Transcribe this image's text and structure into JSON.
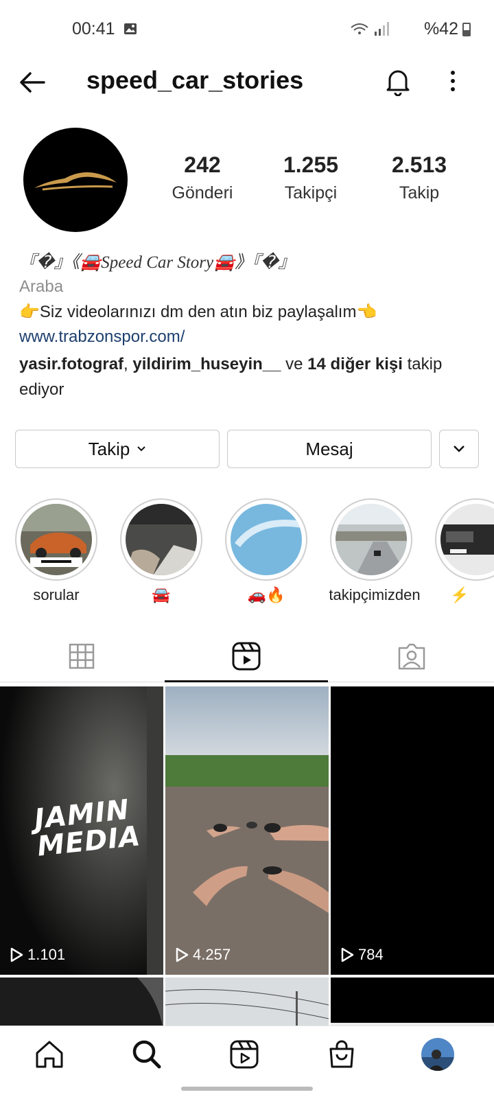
{
  "status": {
    "time": "00:41",
    "battery": "%42",
    "battery_level": 0.42
  },
  "header": {
    "username": "speed_car_stories"
  },
  "profile": {
    "posts": {
      "count": "242",
      "label": "Gönderi"
    },
    "followers": {
      "count": "1.255",
      "label": "Takipçi"
    },
    "following": {
      "count": "2.513",
      "label": "Takip"
    },
    "bio_name": "『�』《🚘Speed Car Story🚘》『�』",
    "category": "Araba",
    "bio_text": "👉Siz videolarınızı dm den atın biz paylaşalım👈",
    "link": "www.trabzonspor.com/",
    "followed_by": {
      "user1": "yasir.fotograf",
      "sep": ", ",
      "user2": "yildirim_huseyin__",
      "ve": " ve ",
      "others": "14 diğer kişi",
      "suffix": " takip ediyor"
    }
  },
  "buttons": {
    "follow": "Takip",
    "message": "Mesaj"
  },
  "highlights": [
    {
      "label": "sorular"
    },
    {
      "label": "🚘"
    },
    {
      "label": "🚗🔥"
    },
    {
      "label": "takipçimizden"
    },
    {
      "label": "⚡"
    }
  ],
  "grid": [
    {
      "views": "1.101"
    },
    {
      "views": "4.257"
    },
    {
      "views": "784"
    }
  ],
  "tile_text": {
    "t1": "JAMIN",
    "t2": "MEDIA"
  },
  "colors": {
    "link": "#1d3f6e",
    "muted": "#8e8e8e"
  }
}
